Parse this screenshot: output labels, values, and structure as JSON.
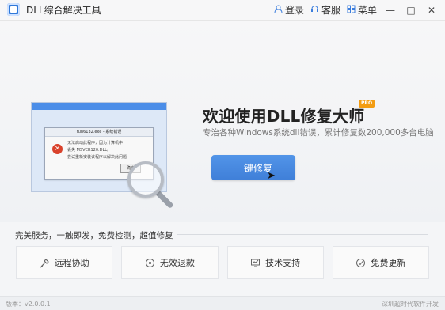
{
  "window": {
    "title": "DLL综合解决工具",
    "actions": [
      {
        "label": "登录",
        "icon": "user-icon"
      },
      {
        "label": "客服",
        "icon": "headset-icon"
      },
      {
        "label": "菜单",
        "icon": "menu-icon"
      }
    ],
    "controls": [
      "—",
      "□",
      "✕"
    ]
  },
  "hero": {
    "title": "欢迎使用DLL修复大师",
    "badge": "PRO",
    "subtitle": "专治各种Windows系统dll错误，累计修复数200,000多台电脑",
    "button": "一键修复",
    "illustration": {
      "dialog_title": "run6132.exe - 系统错误",
      "error_lines": [
        "无法启动此程序，因为计算机中",
        "丢失 MSVCR120.DLL。",
        "尝试重新安装该程序以解决此问题"
      ],
      "ok": "确定"
    }
  },
  "services": {
    "heading": "完美服务，一触即发，免费检测，超值修复",
    "items": [
      {
        "label": "远程协助",
        "icon": "remote-assist-icon"
      },
      {
        "label": "无效退款",
        "icon": "refund-icon"
      },
      {
        "label": "技术支持",
        "icon": "tech-support-icon"
      },
      {
        "label": "免费更新",
        "icon": "update-icon"
      }
    ]
  },
  "status": {
    "version": "版本：v2.0.0.1",
    "vendor": "深圳超时代软件开发"
  },
  "colors": {
    "accent": "#3f7fd8",
    "badge": "#f39c12",
    "error": "#d9422c"
  }
}
